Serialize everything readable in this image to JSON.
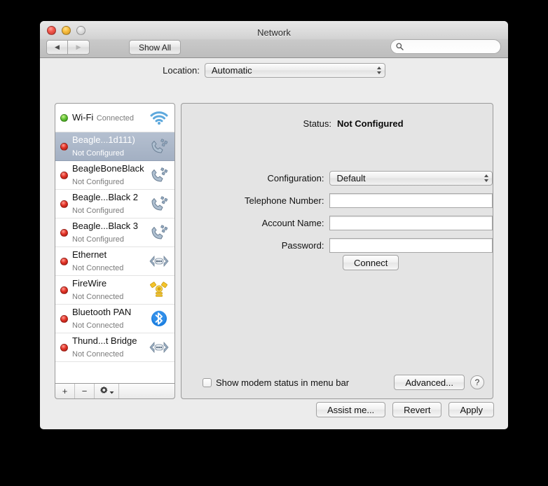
{
  "window": {
    "title": "Network",
    "traffic_lights": [
      "close",
      "minimize",
      "zoom"
    ]
  },
  "toolbar": {
    "back_icon": "triangle-left-icon",
    "forward_icon": "triangle-right-icon",
    "show_all_label": "Show All",
    "search": {
      "value": "",
      "placeholder": "",
      "icon": "search-icon"
    }
  },
  "location": {
    "label": "Location:",
    "selected": "Automatic"
  },
  "sidebar": {
    "items": [
      {
        "name": "Wi-Fi",
        "status": "Connected",
        "dot": "green",
        "icon": "wifi-icon",
        "selected": false
      },
      {
        "name": "Beagle...1d111)",
        "status": "Not Configured",
        "dot": "red",
        "icon": "modem-phone-icon",
        "selected": true
      },
      {
        "name": "BeagleBoneBlack",
        "status": "Not Configured",
        "dot": "red",
        "icon": "modem-phone-icon",
        "selected": false
      },
      {
        "name": "Beagle...Black 2",
        "status": "Not Configured",
        "dot": "red",
        "icon": "modem-phone-icon",
        "selected": false
      },
      {
        "name": "Beagle...Black 3",
        "status": "Not Configured",
        "dot": "red",
        "icon": "modem-phone-icon",
        "selected": false
      },
      {
        "name": "Ethernet",
        "status": "Not Connected",
        "dot": "red",
        "icon": "ethernet-icon",
        "selected": false
      },
      {
        "name": "FireWire",
        "status": "Not Connected",
        "dot": "red",
        "icon": "firewire-icon",
        "selected": false
      },
      {
        "name": "Bluetooth PAN",
        "status": "Not Connected",
        "dot": "red",
        "icon": "bluetooth-icon",
        "selected": false
      },
      {
        "name": "Thund...t Bridge",
        "status": "Not Connected",
        "dot": "red",
        "icon": "ethernet-icon",
        "selected": false
      }
    ],
    "buttons": {
      "add": "+",
      "remove": "−",
      "actions_icon": "gear-icon",
      "actions_chevron": "chevron-down-icon"
    }
  },
  "detail": {
    "status_label": "Status:",
    "status_value": "Not Configured",
    "configuration_label": "Configuration:",
    "configuration_value": "Default",
    "telephone_label": "Telephone Number:",
    "telephone_value": "",
    "account_label": "Account Name:",
    "account_value": "",
    "password_label": "Password:",
    "password_value": "",
    "connect_label": "Connect",
    "show_modem_label": "Show modem status in menu bar",
    "show_modem_checked": false,
    "advanced_label": "Advanced...",
    "help_label": "?"
  },
  "footer": {
    "assist_label": "Assist me...",
    "revert_label": "Revert",
    "apply_label": "Apply"
  },
  "colors": {
    "selection": "#a9b5c8",
    "connected_dot": "#63c335",
    "disconnected_dot": "#e33226",
    "window_bg": "#ececec",
    "detail_bg": "#e4e4e4"
  }
}
